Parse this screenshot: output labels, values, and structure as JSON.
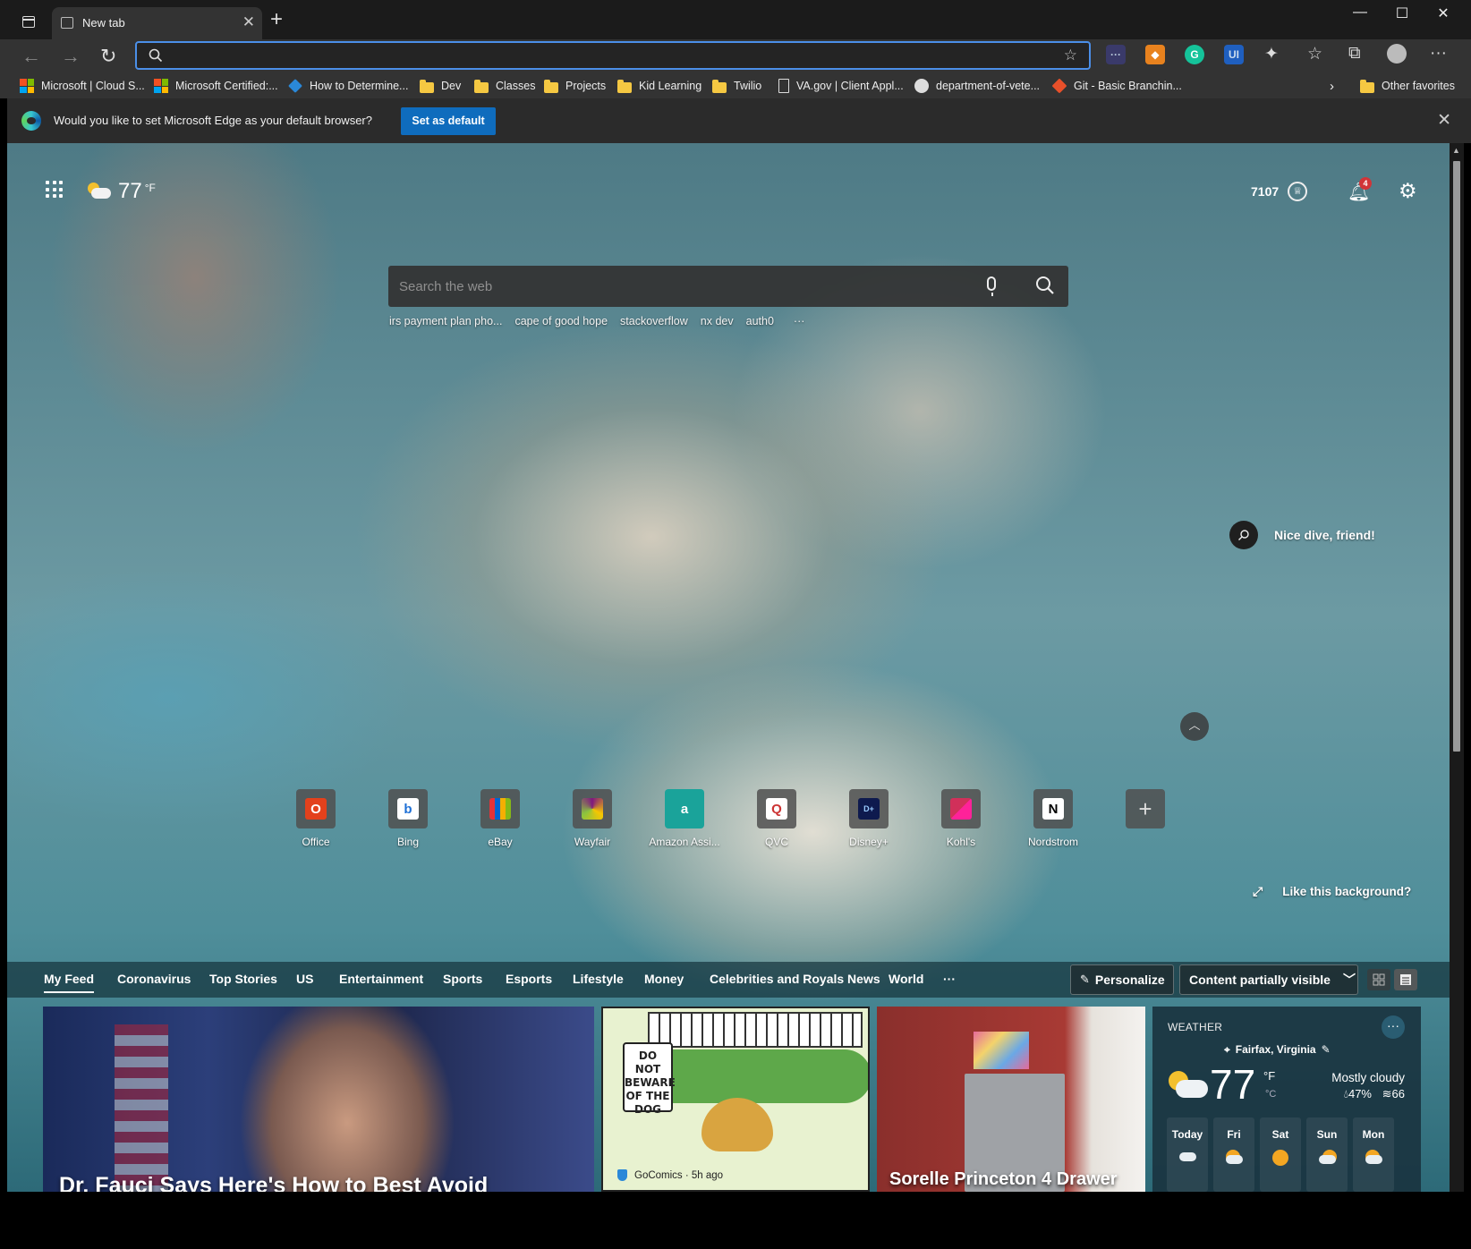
{
  "browser": {
    "tab_title": "New tab",
    "window_controls": {
      "minimize": "—",
      "maximize": "☐",
      "close": "✕"
    },
    "address_placeholder": ""
  },
  "favorites": [
    {
      "label": "Microsoft | Cloud S...",
      "icon": "microsoft-logo-icon"
    },
    {
      "label": "Microsoft Certified:...",
      "icon": "microsoft-logo-icon"
    },
    {
      "label": "How to Determine...",
      "icon": "deploy-icon"
    },
    {
      "label": "Dev",
      "icon": "folder-icon"
    },
    {
      "label": "Classes",
      "icon": "folder-icon"
    },
    {
      "label": "Projects",
      "icon": "folder-icon"
    },
    {
      "label": "Kid Learning",
      "icon": "folder-icon"
    },
    {
      "label": "Twilio",
      "icon": "folder-icon"
    },
    {
      "label": "VA.gov | Client Appl...",
      "icon": "document-icon"
    },
    {
      "label": "department-of-vete...",
      "icon": "github-icon"
    },
    {
      "label": "Git - Basic Branchin...",
      "icon": "git-icon"
    }
  ],
  "favorites_other": "Other favorites",
  "notification": {
    "message": "Would you like to set Microsoft Edge as your default browser?",
    "button": "Set as default"
  },
  "ntp": {
    "weather_temp": "77",
    "weather_unit": "°F",
    "rewards_points": "7107",
    "notification_count": "4",
    "search_placeholder": "Search the web",
    "trending": [
      "irs payment plan pho...",
      "cape of good hope",
      "stackoverflow",
      "nx dev",
      "auth0"
    ],
    "trending_more": "···",
    "image_caption": "Nice dive, friend!",
    "like_background": "Like this background?",
    "tiles": [
      {
        "label": "Office",
        "icon": "office-icon"
      },
      {
        "label": "Bing",
        "icon": "bing-icon"
      },
      {
        "label": "eBay",
        "icon": "ebay-icon"
      },
      {
        "label": "Wayfair",
        "icon": "wayfair-icon"
      },
      {
        "label": "Amazon Assi...",
        "icon": "amazon-assistant-icon"
      },
      {
        "label": "QVC",
        "icon": "qvc-icon"
      },
      {
        "label": "Disney+",
        "icon": "disney-plus-icon"
      },
      {
        "label": "Kohl's",
        "icon": "kohls-icon"
      },
      {
        "label": "Nordstrom",
        "icon": "nordstrom-icon"
      }
    ]
  },
  "feed": {
    "tabs": [
      "My Feed",
      "Coronavirus",
      "Top Stories",
      "US",
      "Entertainment",
      "Sports",
      "Esports",
      "Lifestyle",
      "Money",
      "Celebrities and Royals News",
      "World"
    ],
    "more": "···",
    "personalize": "Personalize",
    "visibility": "Content partially visible",
    "cards": {
      "fauci_headline": "Dr. Fauci Says Here's How to Best Avoid",
      "comic_sign": "DO NOT BEWARE OF THE DOG",
      "comic_source": "GoComics · 5h ago",
      "dresser_headline": "Sorelle Princeton 4 Drawer"
    },
    "weather": {
      "header": "WEATHER",
      "location": "Fairfax, Virginia",
      "temp": "77",
      "unit_f": "°F",
      "unit_c": "°C",
      "condition": "Mostly cloudy",
      "humidity": "47%",
      "wind": "66",
      "forecast": [
        {
          "day": "Today",
          "icon": "cloudy-icon"
        },
        {
          "day": "Fri",
          "icon": "partly-sunny-icon"
        },
        {
          "day": "Sat",
          "icon": "sunny-icon"
        },
        {
          "day": "Sun",
          "icon": "partly-cloudy-icon"
        },
        {
          "day": "Mon",
          "icon": "partly-sunny-icon"
        }
      ]
    }
  },
  "colors": {
    "accent": "#0f6cbd",
    "address_focus": "#4b8fe8",
    "badge": "#d13438"
  }
}
